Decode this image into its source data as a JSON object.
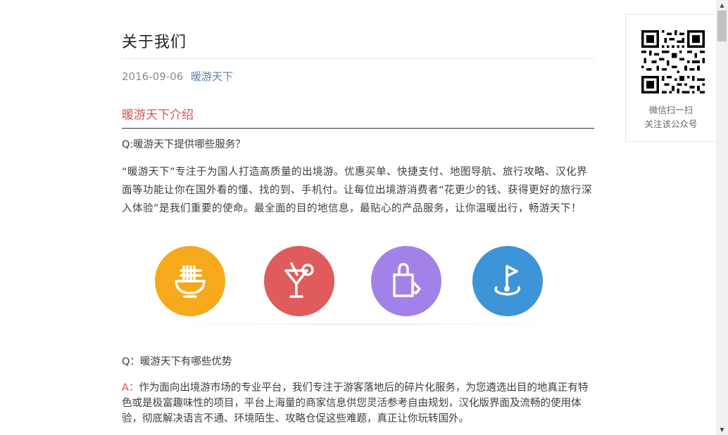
{
  "article": {
    "title": "关于我们",
    "date": "2016-09-06",
    "author": "暖游天下",
    "section_heading": "暖游天下介绍",
    "q1": "Q:暖游天下提供哪些服务？",
    "intro_paragraph": "“暖游天下”专注于为国人打造高质量的出境游。优惠买单、快捷支付、地图导航、旅行攻略、汉化界面等功能让你在国外看的懂、找的到、手机付。让每位出境游消费者“花更少的钱、获得更好的旅行深入体验”是我们重要的使命。最全面的目的地信息，最贴心的产品服务，让你温暖出行，畅游天下！",
    "icons": [
      {
        "name": "noodle-bowl-icon",
        "color": "#f6a91b"
      },
      {
        "name": "cocktail-icon",
        "color": "#e05b5b"
      },
      {
        "name": "shopping-bag-icon",
        "color": "#a282e8"
      },
      {
        "name": "map-pin-icon",
        "color": "#3d94d7"
      }
    ],
    "q2": "Q：暖游天下有哪些优势",
    "answer_prefix": "A：",
    "answer_text": "作为面向出境游市场的专业平台，我们专注于游客落地后的碎片化服务，为您遴选出目的地真正有特色或是极富趣味性的项目，平台上海量的商家信息供您灵活参考自由规划，汉化版界面及流畅的使用体验，彻底解决语言不通、环境陌生、攻略仓促这些难题，真正让你玩转国外。"
  },
  "qr_panel": {
    "line1": "微信扫一扫",
    "line2": "关注该公众号"
  },
  "colors": {
    "accent_red": "#d9534f",
    "link_blue": "#607fa6"
  }
}
